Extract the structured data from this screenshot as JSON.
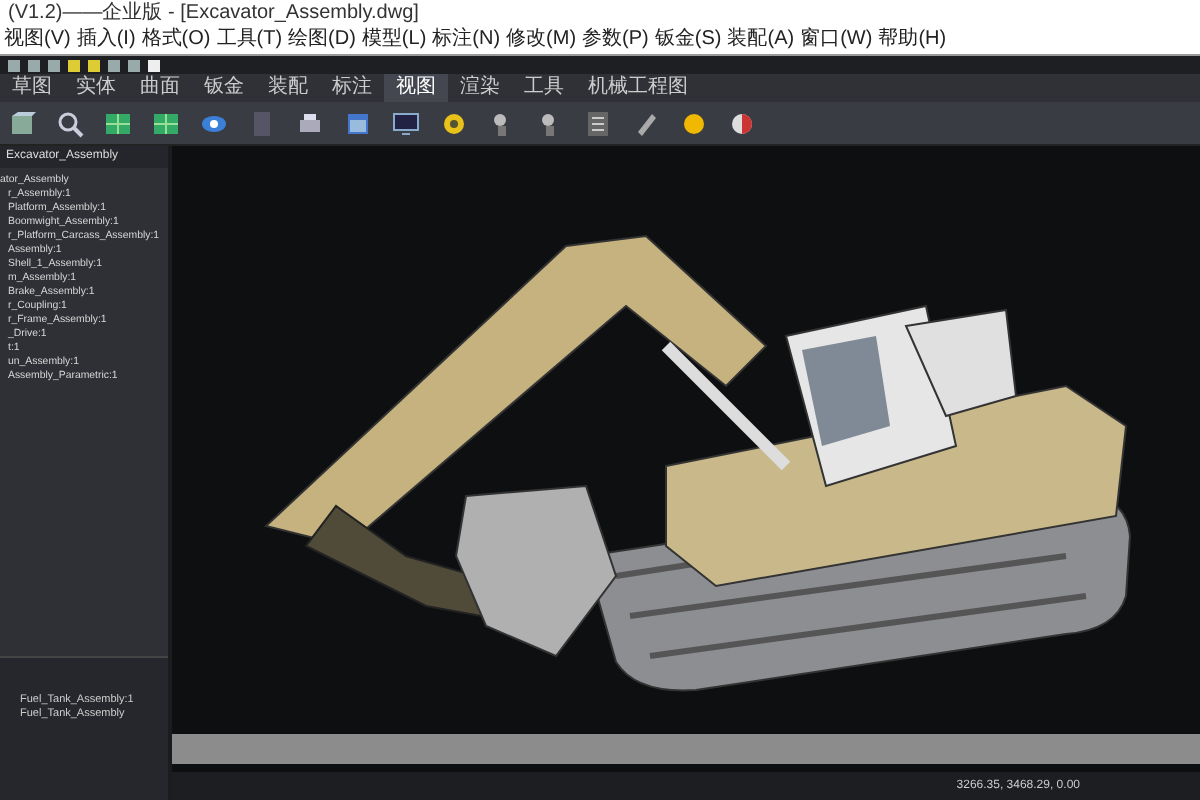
{
  "window": {
    "title": "(V1.2)——企业版 - [Excavator_Assembly.dwg]"
  },
  "menu": [
    "视图(V)",
    "插入(I)",
    "格式(O)",
    "工具(T)",
    "绘图(D)",
    "模型(L)",
    "标注(N)",
    "修改(M)",
    "参数(P)",
    "钣金(S)",
    "装配(A)",
    "窗口(W)",
    "帮助(H)"
  ],
  "ribbon_tabs": [
    {
      "label": "草图",
      "selected": false
    },
    {
      "label": "实体",
      "selected": false
    },
    {
      "label": "曲面",
      "selected": false
    },
    {
      "label": "钣金",
      "selected": false
    },
    {
      "label": "装配",
      "selected": false
    },
    {
      "label": "标注",
      "selected": false
    },
    {
      "label": "视图",
      "selected": true
    },
    {
      "label": "渲染",
      "selected": false
    },
    {
      "label": "工具",
      "selected": false
    },
    {
      "label": "机械工程图",
      "selected": false
    }
  ],
  "panel": {
    "tab": "Excavator_Assembly",
    "tree": [
      {
        "label": "ator_Assembly",
        "children": [
          {
            "label": "r_Assembly:1"
          },
          {
            "label": "Platform_Assembly:1"
          },
          {
            "label": "Boomwight_Assembly:1"
          },
          {
            "label": "r_Platform_Carcass_Assembly:1"
          },
          {
            "label": "Assembly:1"
          },
          {
            "label": "Shell_1_Assembly:1"
          },
          {
            "label": "m_Assembly:1"
          },
          {
            "label": "Brake_Assembly:1"
          },
          {
            "label": "r_Coupling:1"
          },
          {
            "label": "r_Frame_Assembly:1"
          },
          {
            "label": "_Drive:1"
          },
          {
            "label": "t:1"
          },
          {
            "label": "un_Assembly:1"
          },
          {
            "label": "Assembly_Parametric:1"
          }
        ]
      }
    ],
    "properties": [
      "Fuel_Tank_Assembly:1",
      "Fuel_Tank_Assembly"
    ]
  },
  "status_bar": {
    "coordinates": "3266.35, 3468.29, 0.00"
  }
}
